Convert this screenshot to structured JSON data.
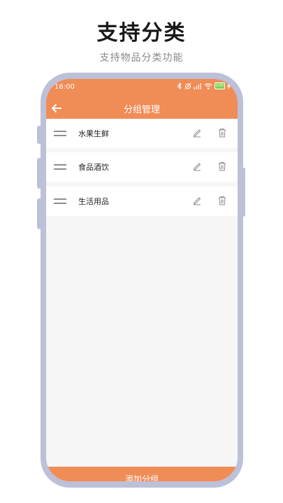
{
  "promo": {
    "title": "支持分类",
    "subtitle": "支持物品分类功能"
  },
  "statusbar": {
    "time": "16:00",
    "battery": "100"
  },
  "appbar": {
    "title": "分组管理"
  },
  "groups": [
    {
      "label": "水果生鲜"
    },
    {
      "label": "食品酒饮"
    },
    {
      "label": "生活用品"
    }
  ],
  "footer": {
    "add_label": "添加分组"
  },
  "colors": {
    "accent": "#f08c56",
    "frame": "#bcc0d8",
    "screen_bg": "#f6f6f6"
  }
}
